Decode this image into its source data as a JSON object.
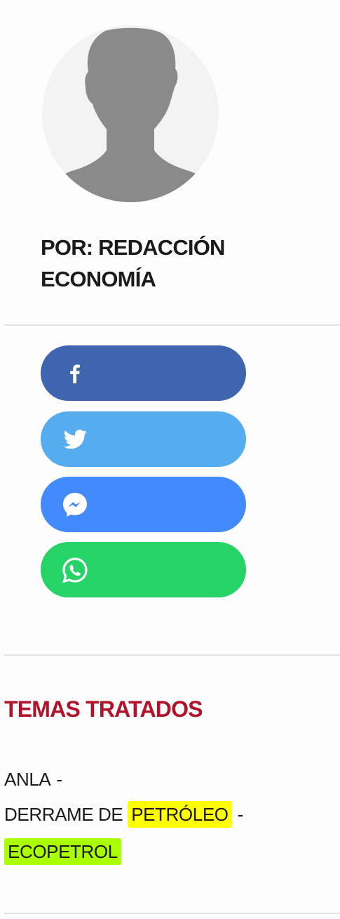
{
  "author": {
    "line1": "POR: REDACCIÓN",
    "line2": "ECONOMÍA"
  },
  "share": {
    "buttons": [
      {
        "network": "facebook",
        "icon": "facebook-icon",
        "color": "#3e65ad"
      },
      {
        "network": "twitter",
        "icon": "twitter-icon",
        "color": "#55acee"
      },
      {
        "network": "messenger",
        "icon": "messenger-icon",
        "color": "#448aff"
      },
      {
        "network": "whatsapp",
        "icon": "whatsapp-icon",
        "color": "#25d366"
      }
    ]
  },
  "topics": {
    "title": "TEMAS TRATADOS",
    "title_color": "#b0132a",
    "separator": "-",
    "items": [
      {
        "label": "ANLA",
        "highlight": ""
      },
      {
        "label": "DERRAME DE ",
        "highlight": ""
      },
      {
        "label": "PETRÓLEO",
        "highlight": "#ffff00"
      },
      {
        "label": "ECOPETROL",
        "highlight": "#aaff00"
      }
    ]
  }
}
